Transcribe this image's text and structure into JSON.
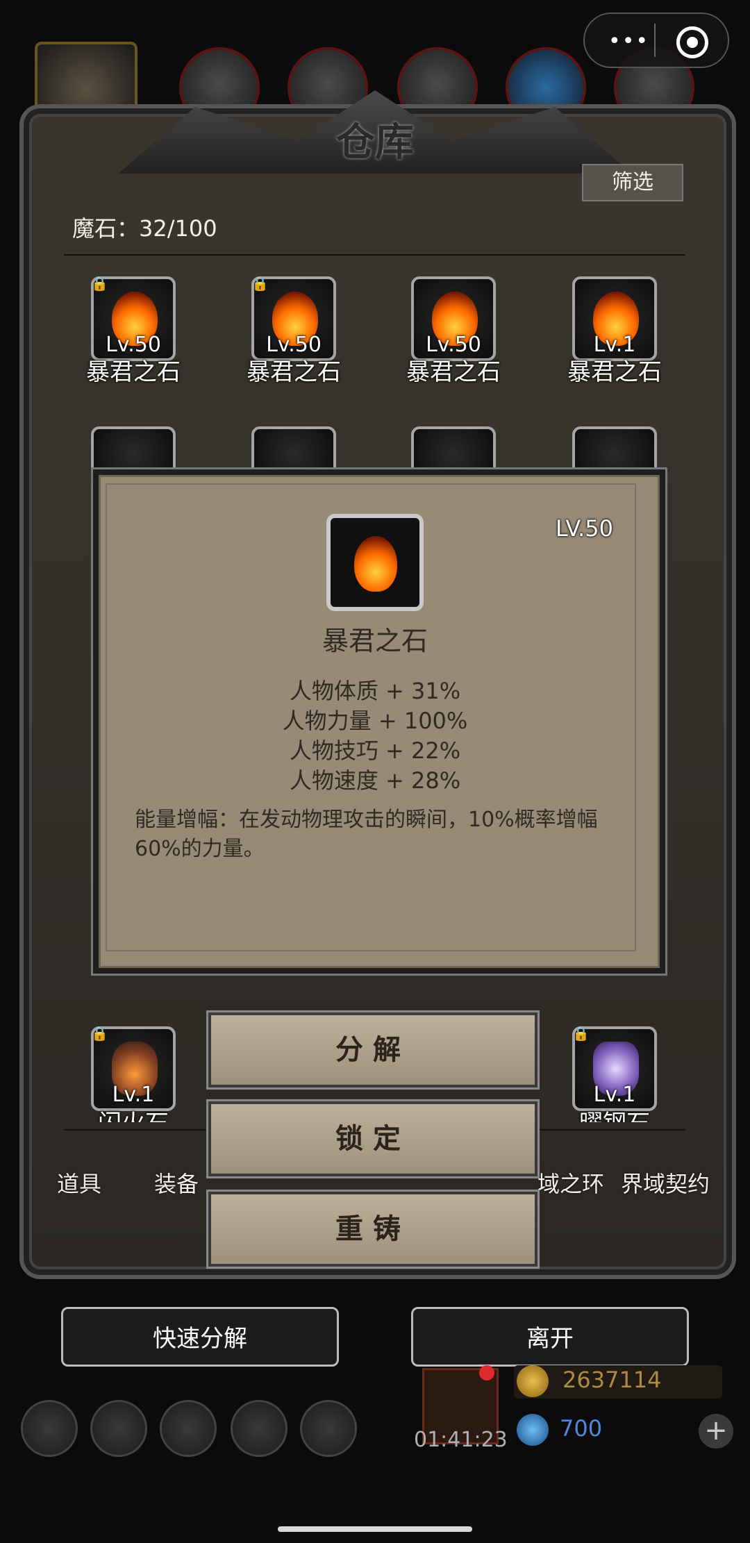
{
  "header": {
    "title": "仓库",
    "filter_label": "筛选"
  },
  "stone_count": "魔石：32/100",
  "capsule": {
    "menu_icon": "more-dots-icon",
    "close_icon": "target-icon"
  },
  "grid_row1": [
    {
      "lv": "Lv.50",
      "name": "暴君之石",
      "locked": true
    },
    {
      "lv": "Lv.50",
      "name": "暴君之石",
      "locked": true
    },
    {
      "lv": "Lv.50",
      "name": "暴君之石",
      "locked": false
    },
    {
      "lv": "Lv.1",
      "name": "暴君之石",
      "locked": false
    }
  ],
  "grid_row4": [
    {
      "lv": "Lv.1",
      "name": "闪火石",
      "locked": true
    },
    {
      "lv": "Lv.1",
      "name": "曜钢石",
      "locked": true
    }
  ],
  "tabs": [
    "道具",
    "装备",
    "域之环",
    "界域契约"
  ],
  "popup": {
    "lv": "LV.50",
    "name": "暴君之石",
    "stats": [
      "人物体质 + 31%",
      "人物力量 + 100%",
      "人物技巧 + 22%",
      "人物速度 + 28%"
    ],
    "desc": "能量增幅：在发动物理攻击的瞬间，10%概率增幅60%的力量。"
  },
  "actions": {
    "decompose": "分解",
    "lock": "锁定",
    "recast": "重铸"
  },
  "bottom": {
    "quick_decompose": "快速分解",
    "leave": "离开"
  },
  "footer": {
    "timer": "01:41:23",
    "gold": "2637114",
    "gems": "700"
  }
}
